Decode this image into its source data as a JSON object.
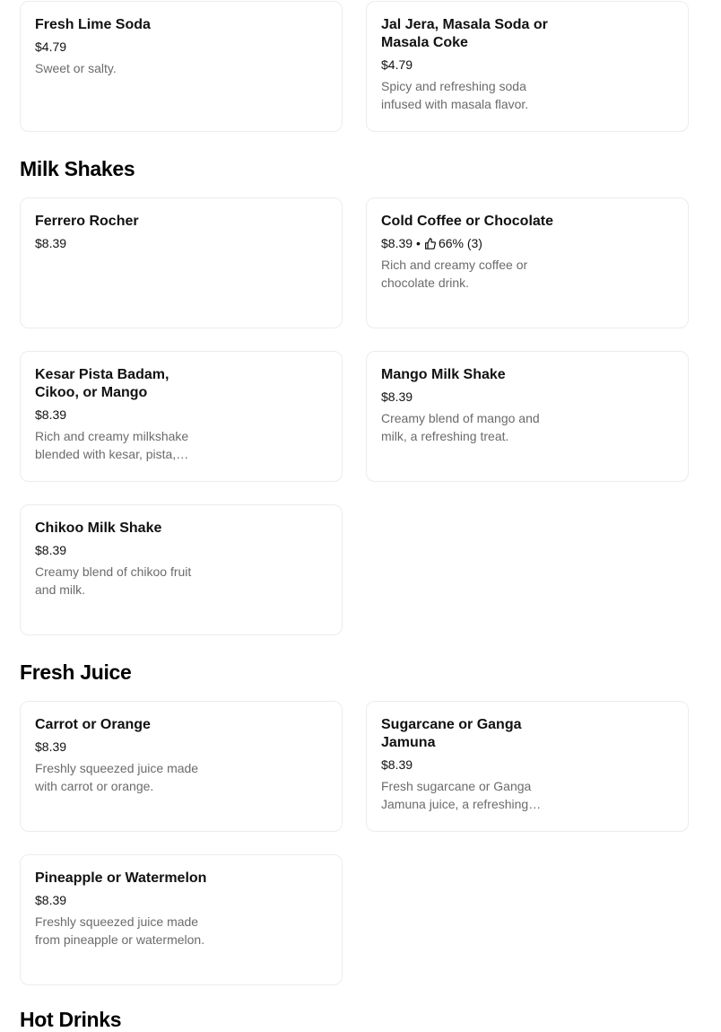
{
  "sections": {
    "top": {
      "items": [
        {
          "name": "Fresh Lime Soda",
          "price": "$4.79",
          "description": "Sweet or salty."
        },
        {
          "name": "Jal Jera, Masala Soda or Masala Coke",
          "price": "$4.79",
          "description": "Spicy and refreshing soda infused with masala flavor."
        }
      ]
    },
    "milk_shakes": {
      "title": "Milk Shakes",
      "items": [
        {
          "name": "Ferrero Rocher",
          "price": "$8.39",
          "description": ""
        },
        {
          "name": "Cold Coffee or Chocolate",
          "price": "$8.39",
          "separator": "•",
          "rating": "66% (3)",
          "description": "Rich and creamy coffee or chocolate drink."
        },
        {
          "name": "Kesar Pista Badam, Cikoo, or Mango",
          "price": "$8.39",
          "description": "Rich and creamy milkshake blended with kesar, pista, badam, chikoo, or mango."
        },
        {
          "name": "Mango Milk Shake",
          "price": "$8.39",
          "description": "Creamy blend of mango and milk, a refreshing treat."
        },
        {
          "name": "Chikoo Milk Shake",
          "price": "$8.39",
          "description": "Creamy blend of chikoo fruit and milk."
        }
      ]
    },
    "fresh_juice": {
      "title": "Fresh Juice",
      "items": [
        {
          "name": "Carrot or Orange",
          "price": "$8.39",
          "description": "Freshly squeezed juice made with carrot or orange."
        },
        {
          "name": "Sugarcane or Ganga Jamuna",
          "price": "$8.39",
          "description": "Fresh sugarcane or Ganga Jamuna juice, a refreshing blend."
        },
        {
          "name": "Pineapple or Watermelon",
          "price": "$8.39",
          "description": "Freshly squeezed juice made from pineapple or watermelon."
        }
      ]
    },
    "hot_drinks": {
      "title": "Hot Drinks"
    }
  }
}
